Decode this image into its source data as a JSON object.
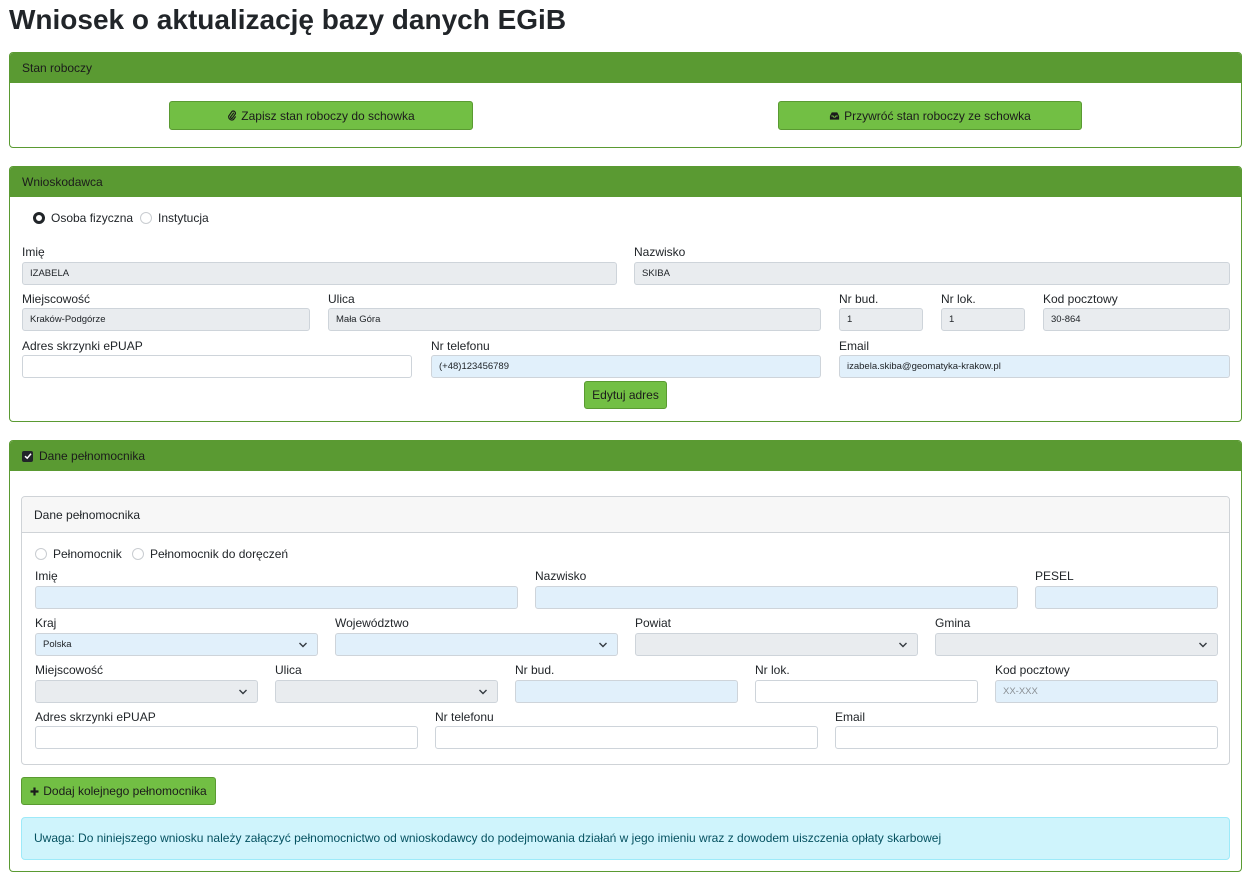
{
  "page": {
    "title": "Wniosek o aktualizację bazy danych EGiB"
  },
  "draft": {
    "header": "Stan roboczy",
    "save_label": "Zapisz stan roboczy do schowka",
    "restore_label": "Przywróć stan roboczy ze schowka"
  },
  "applicant": {
    "header": "Wnioskodawca",
    "type_person": "Osoba fizyczna",
    "type_institution": "Instytucja",
    "selected_type": "Osoba fizyczna",
    "first_name_label": "Imię",
    "first_name": "IZABELA",
    "last_name_label": "Nazwisko",
    "last_name": "SKIBA",
    "city_label": "Miejscowość",
    "city": "Kraków-Podgórze",
    "street_label": "Ulica",
    "street": "Mała Góra",
    "building_label": "Nr bud.",
    "building": "1",
    "apartment_label": "Nr lok.",
    "apartment": "1",
    "postal_label": "Kod pocztowy",
    "postal": "30-864",
    "epuap_label": "Adres skrzynki ePUAP",
    "epuap": "",
    "phone_label": "Nr telefonu",
    "phone": "(+48)123456789",
    "email_label": "Email",
    "email": "izabela.skiba@geomatyka-krakow.pl",
    "edit_address_label": "Edytuj adres"
  },
  "proxy": {
    "header": "Dane pełnomocnika",
    "checked": true,
    "inner_header": "Dane pełnomocnika",
    "type_proxy": "Pełnomocnik",
    "type_delivery": "Pełnomocnik do doręczeń",
    "first_name_label": "Imię",
    "last_name_label": "Nazwisko",
    "pesel_label": "PESEL",
    "country_label": "Kraj",
    "country": "Polska",
    "voivodeship_label": "Województwo",
    "county_label": "Powiat",
    "commune_label": "Gmina",
    "city_label": "Miejscowość",
    "street_label": "Ulica",
    "building_label": "Nr bud.",
    "apartment_label": "Nr lok.",
    "postal_label": "Kod pocztowy",
    "postal_placeholder": "XX-XXX",
    "epuap_label": "Adres skrzynki ePUAP",
    "phone_label": "Nr telefonu",
    "email_label": "Email",
    "add_label": "Dodaj kolejnego pełnomocnika",
    "notice": "Uwaga: Do niniejszego wniosku należy załączyć pełnomocnictwo od wnioskodawcy do podejmowania działań w jego imieniu wraz z dowodem uiszczenia opłaty skarbowej"
  },
  "colors": {
    "header_green": "#5a9a32",
    "button_green": "#72bf44",
    "field_gray": "#e9ecef",
    "field_blue": "#e1f0fb",
    "alert_bg": "#cff4fc"
  },
  "icons": {
    "save": "paperclip-icon",
    "restore": "inbox-icon",
    "add": "plus-icon",
    "select": "chevron-down-icon",
    "checkbox": "checkbox-checked-icon"
  }
}
